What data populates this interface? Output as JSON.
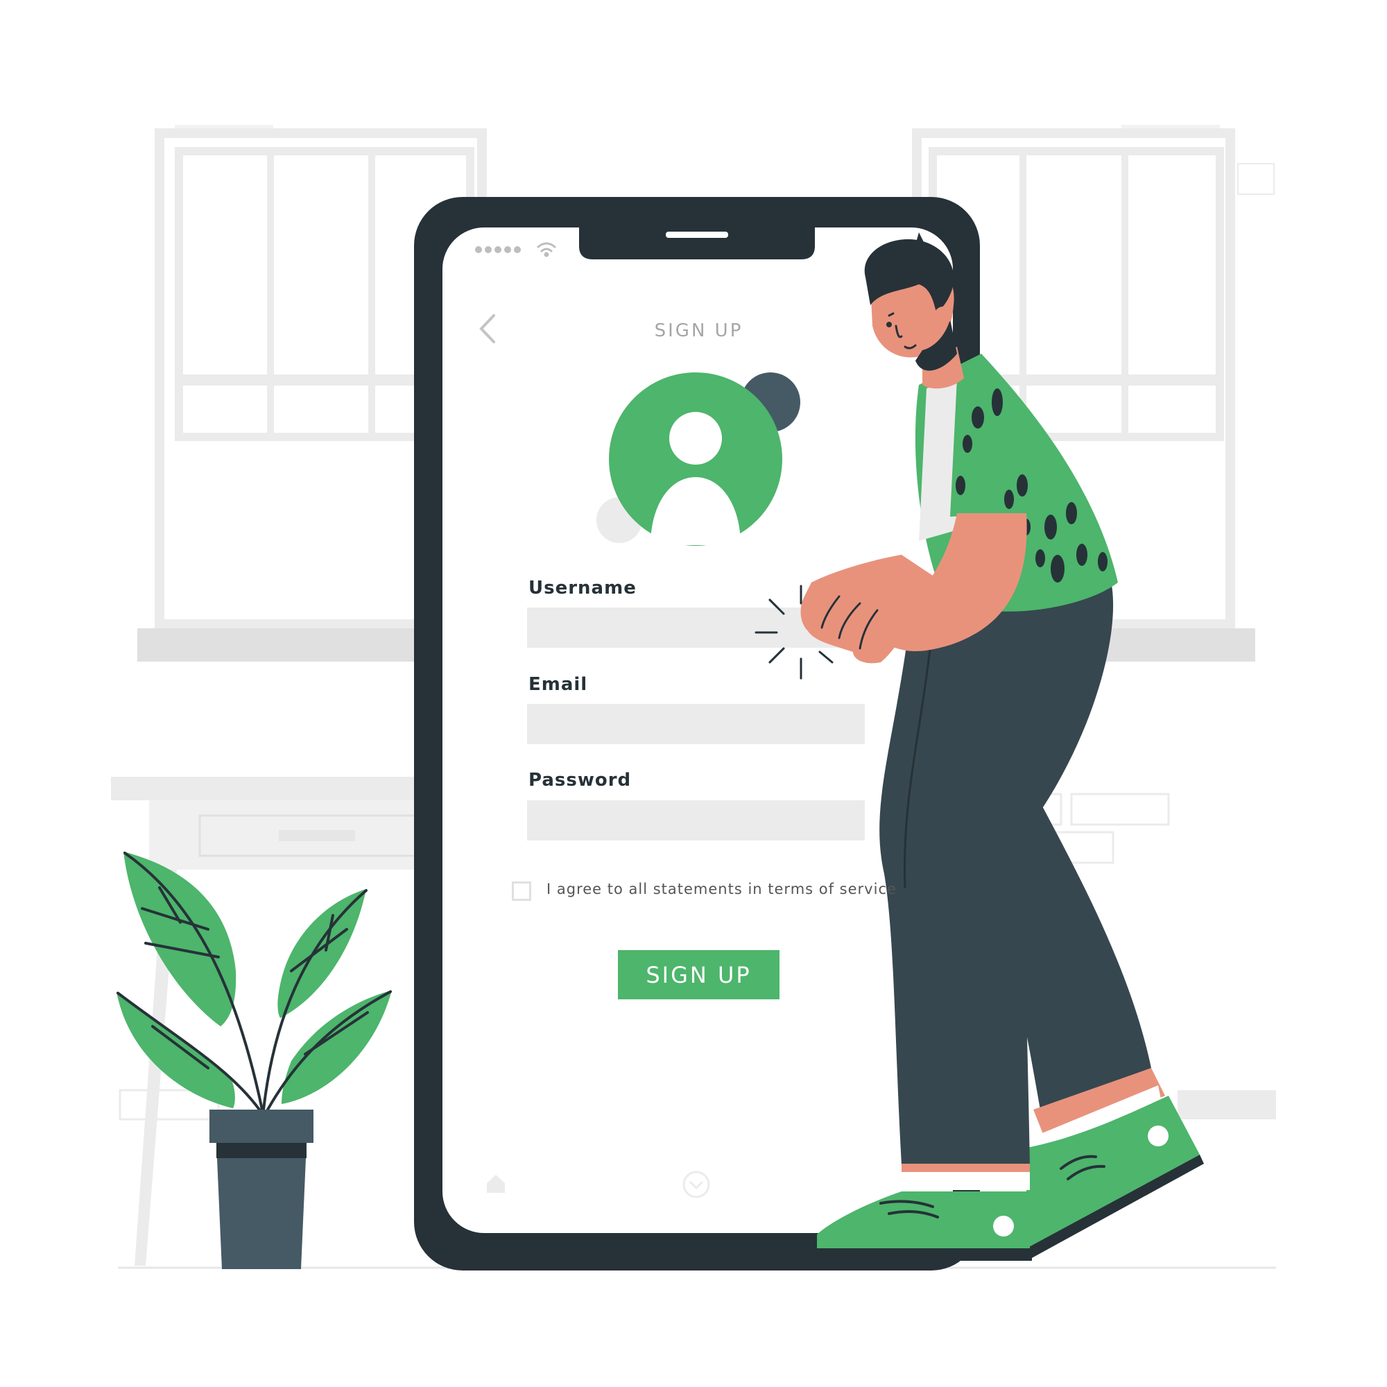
{
  "screen": {
    "title": "SIGN UP",
    "fields": [
      {
        "label": "Username",
        "value": ""
      },
      {
        "label": "Email",
        "value": ""
      },
      {
        "label": "Password",
        "value": ""
      }
    ],
    "terms_text": "I agree to all statements in terms of service",
    "terms_checked": false,
    "submit_label": "SIGN UP"
  },
  "colors": {
    "accent": "#4db56c",
    "dark": "#263238",
    "field": "#ebebeb"
  }
}
